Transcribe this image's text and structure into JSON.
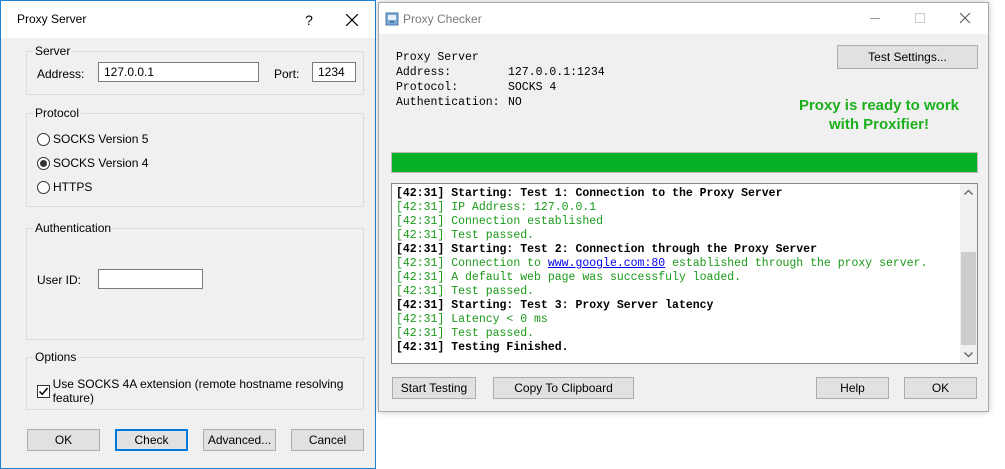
{
  "proxy_server_dialog": {
    "title": "Proxy Server",
    "help_glyph": "?",
    "server": {
      "group_label": "Server",
      "address_label": "Address:",
      "address_value": "127.0.0.1",
      "port_label": "Port:",
      "port_value": "1234"
    },
    "protocol": {
      "group_label": "Protocol",
      "options": [
        "SOCKS Version 5",
        "SOCKS Version 4",
        "HTTPS"
      ],
      "selected": "SOCKS Version 4"
    },
    "authentication": {
      "group_label": "Authentication",
      "userid_label": "User ID:",
      "userid_value": ""
    },
    "options": {
      "group_label": "Options",
      "socks4a_label": "Use SOCKS 4A extension (remote hostname resolving feature)",
      "socks4a_checked": true
    },
    "buttons": {
      "ok": "OK",
      "check": "Check",
      "advanced": "Advanced...",
      "cancel": "Cancel"
    }
  },
  "proxy_checker": {
    "title": "Proxy Checker",
    "info": {
      "heading": "Proxy Server",
      "address_label": "Address:",
      "address_value": "127.0.0.1:1234",
      "protocol_label": "Protocol:",
      "protocol_value": "SOCKS 4",
      "auth_label": "Authentication:",
      "auth_value": "NO"
    },
    "test_settings_button": "Test Settings...",
    "status_line1": "Proxy is ready to work",
    "status_line2": "with Proxifier!",
    "progress_fraction": 1.0,
    "log": [
      {
        "time": "[42:31]",
        "text": "Starting: Test 1: Connection to the Proxy Server",
        "style": "h"
      },
      {
        "time": "[42:31]",
        "text": "IP Address: 127.0.0.1",
        "style": "g"
      },
      {
        "time": "[42:31]",
        "text": "Connection established",
        "style": "g"
      },
      {
        "time": "[42:31]",
        "text": "Test passed.",
        "style": "g"
      },
      {
        "time": "[42:31]",
        "text": "Starting: Test 2: Connection through the Proxy Server",
        "style": "h"
      },
      {
        "time": "[42:31]",
        "text": "Connection to ",
        "link": "www.google.com:80",
        "after": " established through the proxy server.",
        "style": "g"
      },
      {
        "time": "[42:31]",
        "text": "A default web page was successfuly loaded.",
        "style": "g"
      },
      {
        "time": "[42:31]",
        "text": "Test passed.",
        "style": "g"
      },
      {
        "time": "[42:31]",
        "text": "Starting: Test 3: Proxy Server latency",
        "style": "h"
      },
      {
        "time": "[42:31]",
        "text": "Latency < 0 ms",
        "style": "g"
      },
      {
        "time": "[42:31]",
        "text": "Test passed.",
        "style": "g"
      },
      {
        "time": "[42:31]",
        "text": "Testing Finished.",
        "style": "h"
      }
    ],
    "buttons": {
      "start_testing": "Start Testing",
      "copy_clipboard": "Copy To Clipboard",
      "help": "Help",
      "ok": "OK"
    },
    "colors": {
      "status_green": "#1db01d",
      "progress_green": "#06b025"
    }
  }
}
